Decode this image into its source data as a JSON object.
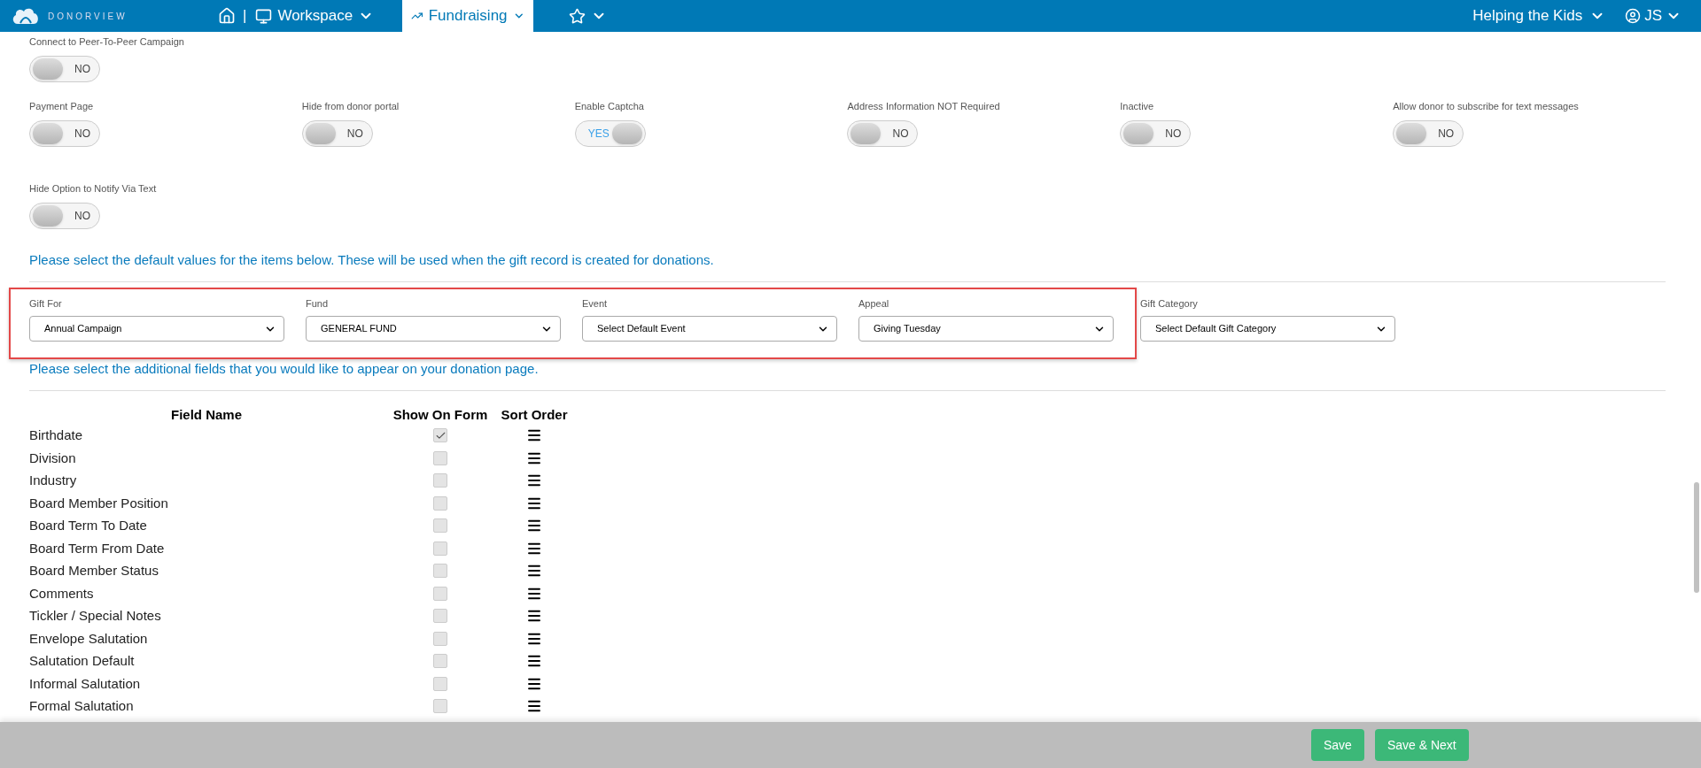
{
  "nav": {
    "logo": "DONORVIEW",
    "separator": "|",
    "items": [
      {
        "kind": "home",
        "selected": false
      },
      {
        "kind": "menu",
        "label": "Workspace",
        "selected": false
      },
      {
        "kind": "menu",
        "label": "Fundraising",
        "selected": true
      },
      {
        "kind": "favorites",
        "selected": false
      }
    ],
    "organization": "Helping the Kids",
    "user": "JS"
  },
  "toggles": [
    {
      "label": "Connect to Peer-To-Peer Campaign",
      "on": false,
      "text": "NO"
    },
    {
      "label": "Payment Page",
      "on": false,
      "text": "NO"
    },
    {
      "label": "Hide from donor portal",
      "on": false,
      "text": "NO"
    },
    {
      "label": "Enable Captcha",
      "on": true,
      "text": "YES"
    },
    {
      "label": "Address Information NOT Required",
      "on": false,
      "text": "NO"
    },
    {
      "label": "Inactive",
      "on": false,
      "text": "NO"
    },
    {
      "label": "Allow donor to subscribe for text messages",
      "on": false,
      "text": "NO"
    },
    {
      "label": "Hide Option to Notify Via Text",
      "on": false,
      "text": "NO"
    }
  ],
  "defaults_intro": "Please select the default values for the items below. These will be used when the gift record is created for donations.",
  "defaults": {
    "highlighted_group": [
      {
        "label": "Gift For",
        "value": "Annual Campaign"
      },
      {
        "label": "Fund",
        "value": "GENERAL FUND"
      },
      {
        "label": "Event",
        "value": "Select Default Event"
      },
      {
        "label": "Appeal",
        "value": "Giving Tuesday"
      }
    ],
    "others": [
      {
        "label": "Gift Category",
        "value": "Select Default Gift Category"
      }
    ]
  },
  "fields_intro": "Please select the additional fields that you would like to appear on your donation page.",
  "table": {
    "columns": [
      "Field Name",
      "Show On Form",
      "Sort Order"
    ],
    "rows": [
      {
        "name": "Birthdate",
        "checked": true
      },
      {
        "name": "Division",
        "checked": false
      },
      {
        "name": "Industry",
        "checked": false
      },
      {
        "name": "Board Member Position",
        "checked": false
      },
      {
        "name": "Board Term To Date",
        "checked": false
      },
      {
        "name": "Board Term From Date",
        "checked": false
      },
      {
        "name": "Board Member Status",
        "checked": false
      },
      {
        "name": "Comments",
        "checked": false
      },
      {
        "name": "Tickler / Special Notes",
        "checked": false
      },
      {
        "name": "Envelope Salutation",
        "checked": false
      },
      {
        "name": "Salutation Default",
        "checked": false
      },
      {
        "name": "Informal Salutation",
        "checked": false
      },
      {
        "name": "Formal Salutation",
        "checked": false
      }
    ]
  },
  "footer": {
    "buttons": [
      "Save",
      "Save & Next"
    ]
  }
}
